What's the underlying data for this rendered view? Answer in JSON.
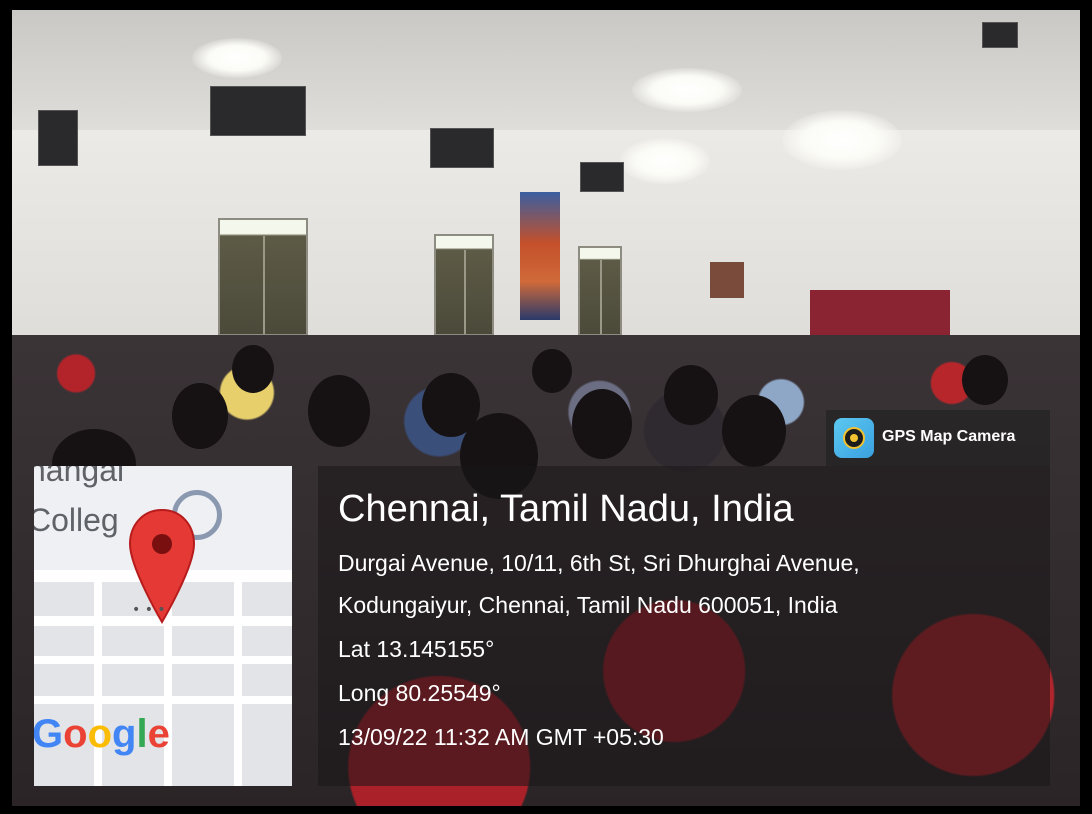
{
  "app": {
    "name": "GPS Map Camera"
  },
  "location": {
    "city_line": "Chennai, Tamil Nadu, India",
    "address_line1": "Durgai Avenue, 10/11, 6th St, Sri Dhurghai Avenue,",
    "address_line2": "Kodungaiyur, Chennai, Tamil Nadu 600051, India",
    "latitude": "Lat 13.145155°",
    "longitude": "Long 80.25549°",
    "timestamp": "13/09/22 11:32 AM GMT +05:30"
  },
  "map": {
    "label_top": "hangai",
    "label_bottom": "Colleg",
    "attribution": "Google",
    "marker_icon": "map-pin-icon",
    "poi_icon": "graduation-cap-icon",
    "pin_color": "#e53935",
    "google_colors": [
      "#4285F4",
      "#EA4335",
      "#FBBC05",
      "#4285F4",
      "#34A853",
      "#EA4335"
    ]
  }
}
